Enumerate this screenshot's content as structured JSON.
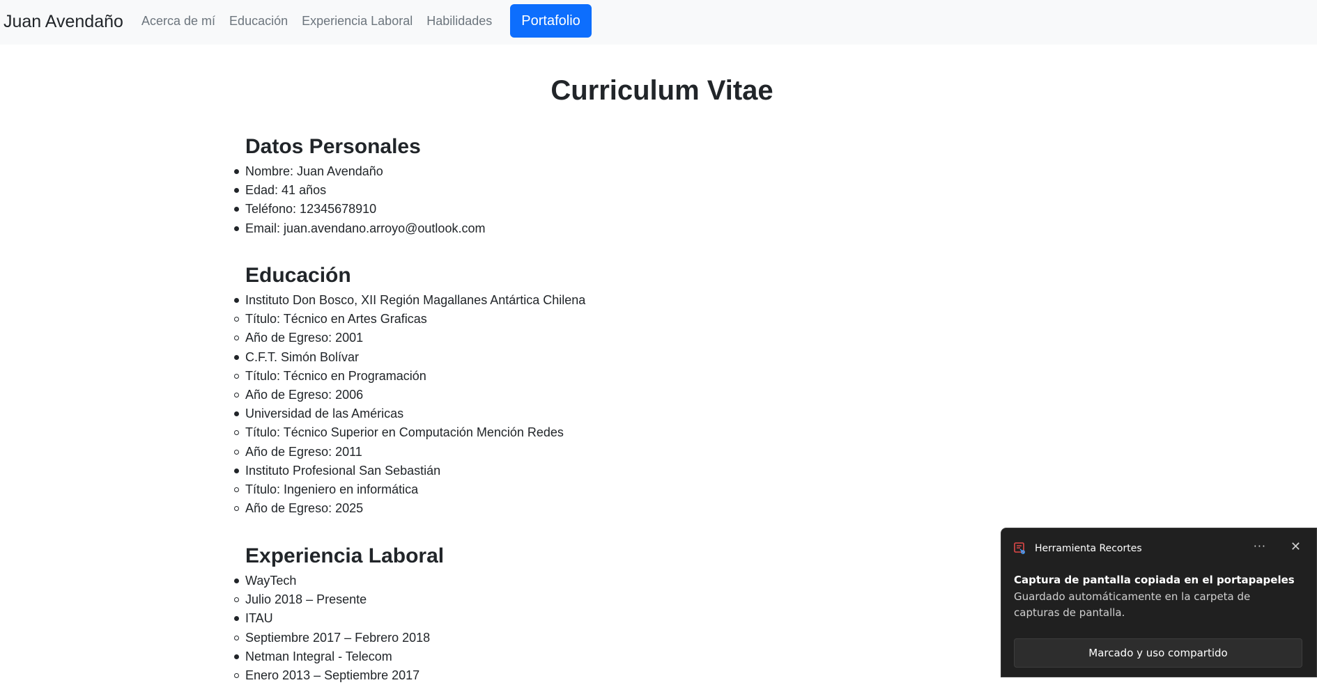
{
  "navbar": {
    "brand": "Juan Avendaño",
    "links": [
      "Acerca de mí",
      "Educación",
      "Experiencia Laboral",
      "Habilidades"
    ],
    "button": "Portafolio",
    "accent_color": "#0d6efd"
  },
  "title": "Curriculum Vitae",
  "personal": {
    "heading": "Datos Personales",
    "items": [
      "Nombre: Juan Avendaño",
      "Edad: 41 años",
      "Teléfono: 12345678910",
      "Email: juan.avendano.arroyo@outlook.com"
    ]
  },
  "education": {
    "heading": "Educación",
    "items": [
      {
        "text": "Instituto Don Bosco, XII Región Magallanes Antártica Chilena",
        "level": "main"
      },
      {
        "text": "Título: Técnico en Artes Graficas",
        "level": "sub"
      },
      {
        "text": "Año de Egreso: 2001",
        "level": "sub"
      },
      {
        "text": "C.F.T. Simón Bolívar",
        "level": "main"
      },
      {
        "text": "Título: Técnico en Programación",
        "level": "sub"
      },
      {
        "text": "Año de Egreso: 2006",
        "level": "sub"
      },
      {
        "text": "Universidad de las Américas",
        "level": "main"
      },
      {
        "text": "Título: Técnico Superior en Computación Mención Redes",
        "level": "sub"
      },
      {
        "text": "Año de Egreso: 2011",
        "level": "sub"
      },
      {
        "text": "Instituto Profesional San Sebastián",
        "level": "main"
      },
      {
        "text": "Título: Ingeniero en informática",
        "level": "sub"
      },
      {
        "text": "Año de Egreso: 2025",
        "level": "sub"
      }
    ]
  },
  "experience": {
    "heading": "Experiencia Laboral",
    "items": [
      {
        "text": "WayTech",
        "level": "main"
      },
      {
        "text": "Julio 2018 – Presente",
        "level": "sub"
      },
      {
        "text": "ITAU",
        "level": "main"
      },
      {
        "text": "Septiembre 2017 – Febrero 2018",
        "level": "sub"
      },
      {
        "text": "Netman Integral - Telecom",
        "level": "main"
      },
      {
        "text": "Enero 2013 – Septiembre 2017",
        "level": "sub"
      }
    ]
  },
  "toast": {
    "app_name": "Herramienta Recortes",
    "more_icon": "more-icon",
    "close_icon": "close-icon",
    "title": "Captura de pantalla copiada en el portapapeles",
    "body": "Guardado automáticamente en la carpeta de capturas de pantalla.",
    "action": "Marcado y uso compartido"
  }
}
